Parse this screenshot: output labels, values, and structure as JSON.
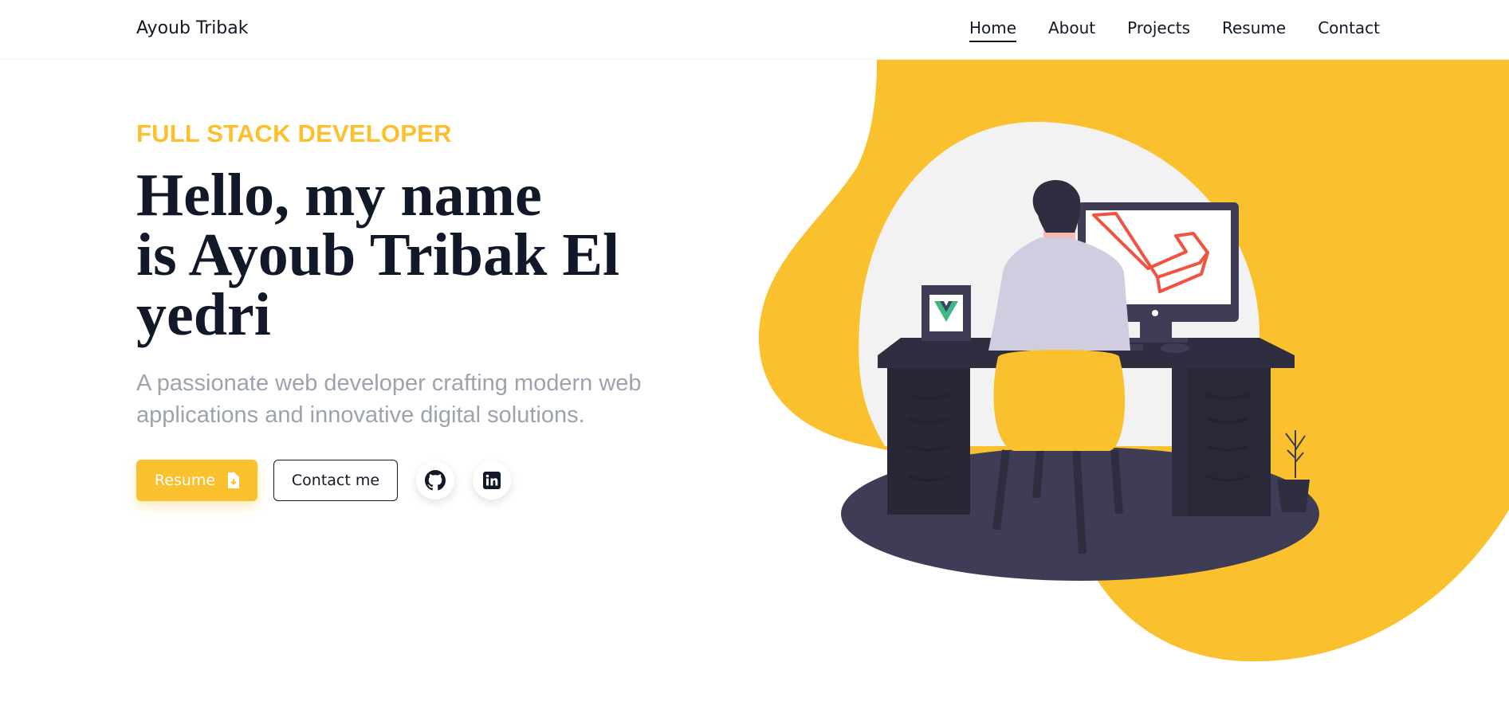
{
  "nav": {
    "brand": "Ayoub Tribak",
    "links": [
      {
        "label": "Home",
        "active": true
      },
      {
        "label": "About",
        "active": false
      },
      {
        "label": "Projects",
        "active": false
      },
      {
        "label": "Resume",
        "active": false
      },
      {
        "label": "Contact",
        "active": false
      }
    ]
  },
  "hero": {
    "eyebrow": "FULL STACK DEVELOPER",
    "title_line1": "Hello, my name",
    "title_line2": "is Ayoub Tribak El",
    "title_line3": "yedri",
    "subtitle": "A passionate web developer crafting modern web applications and innovative digital solutions.",
    "resume_label": "Resume",
    "contact_label": "Contact me"
  },
  "icons": {
    "resume_button": "file-download-icon",
    "github": "github-icon",
    "linkedin": "linkedin-icon"
  },
  "colors": {
    "accent": "#FBC02D",
    "text_dark": "#111827",
    "text_muted": "#9ca3af",
    "desk": "#2f2e41",
    "floor": "#3f3d56",
    "bg_circle": "#f2f2f2",
    "laravel_red": "#f05340",
    "vue_green": "#41b883",
    "vue_dark": "#35495e"
  }
}
